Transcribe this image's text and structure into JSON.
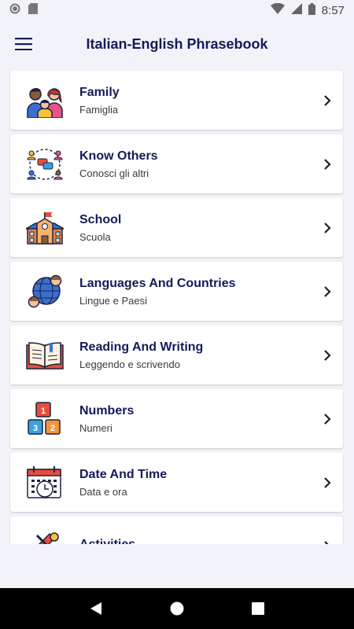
{
  "status": {
    "time": "8:57"
  },
  "app": {
    "title": "Italian-English Phrasebook",
    "accent": "#141a5a"
  },
  "categories": [
    {
      "title": "Family",
      "subtitle": "Famiglia",
      "icon": "family-icon"
    },
    {
      "title": "Know Others",
      "subtitle": "Conosci gli altri",
      "icon": "know-others-icon"
    },
    {
      "title": "School",
      "subtitle": "Scuola",
      "icon": "school-icon"
    },
    {
      "title": "Languages And Countries",
      "subtitle": "Lingue e Paesi",
      "icon": "globe-people-icon"
    },
    {
      "title": "Reading And Writing",
      "subtitle": "Leggendo e scrivendo",
      "icon": "open-book-icon"
    },
    {
      "title": "Numbers",
      "subtitle": "Numeri",
      "icon": "number-blocks-icon"
    },
    {
      "title": "Date And Time",
      "subtitle": "Data e ora",
      "icon": "calendar-clock-icon"
    },
    {
      "title": "Activities",
      "subtitle": "",
      "icon": "activities-icon"
    }
  ],
  "number_blocks": [
    "1",
    "3",
    "2"
  ]
}
